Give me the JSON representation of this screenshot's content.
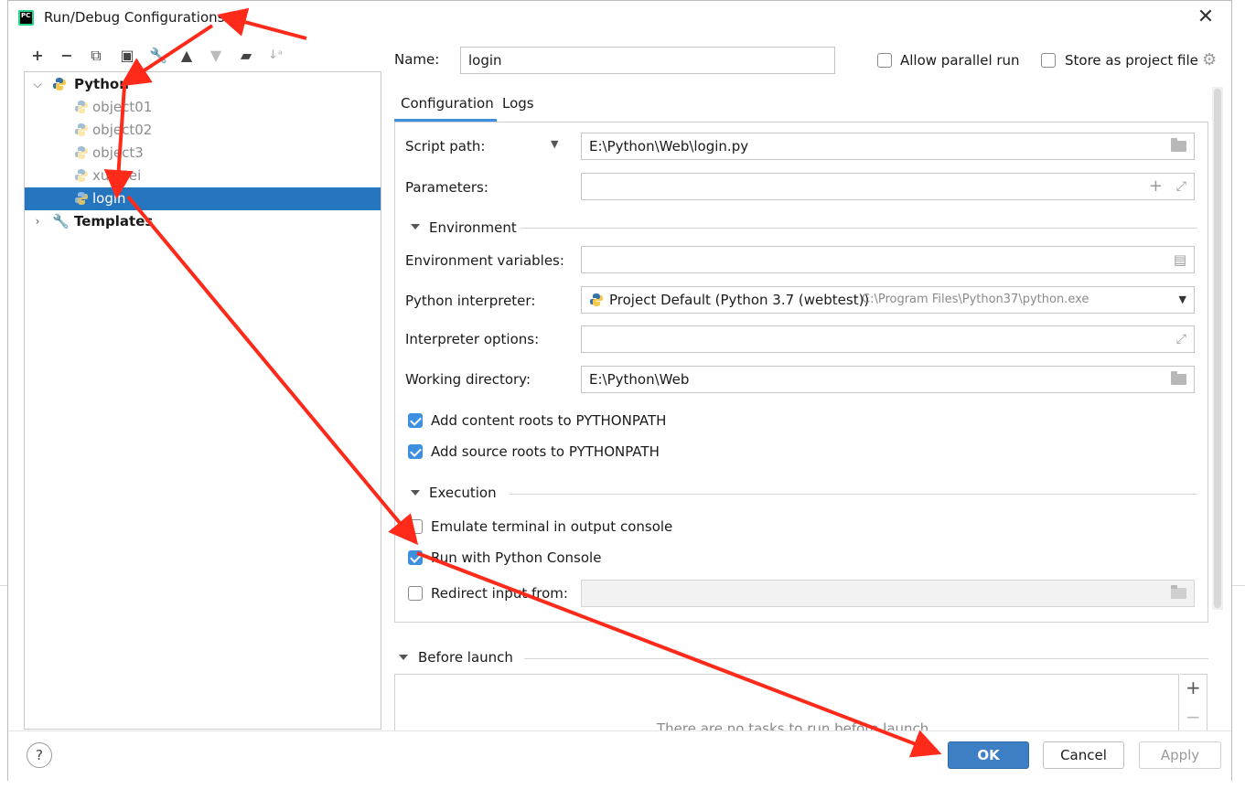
{
  "window": {
    "title": "Run/Debug Configurations",
    "close_icon": "close-icon"
  },
  "toolbar": {
    "icons": [
      "add-icon",
      "remove-icon",
      "copy-icon",
      "save-icon",
      "wrench-icon",
      "move-up-icon",
      "move-down-icon",
      "new-folder-icon",
      "sort-icon"
    ]
  },
  "tree": {
    "python_label": "Python",
    "items": [
      {
        "label": "object01"
      },
      {
        "label": "object02"
      },
      {
        "label": "object3"
      },
      {
        "label": "xuewei"
      },
      {
        "label": "login"
      }
    ],
    "templates_label": "Templates"
  },
  "header": {
    "name_label": "Name:",
    "name_value": "login",
    "allow_parallel_label": "Allow parallel run",
    "allow_parallel_checked": false,
    "store_project_label": "Store as project file",
    "store_project_checked": false
  },
  "tabs": [
    {
      "label": "Configuration",
      "active": true
    },
    {
      "label": "Logs",
      "active": false
    }
  ],
  "config": {
    "script_path_label": "Script path:",
    "script_path_value": "E:\\Python\\Web\\login.py",
    "parameters_label": "Parameters:",
    "parameters_value": "",
    "environment_section": "Environment",
    "env_vars_label": "Environment variables:",
    "env_vars_value": "",
    "interpreter_label": "Python interpreter:",
    "interpreter_value": "Project Default (Python 3.7 (webtest))",
    "interpreter_path": "C:\\Program Files\\Python37\\python.exe",
    "interp_options_label": "Interpreter options:",
    "interp_options_value": "",
    "working_dir_label": "Working directory:",
    "working_dir_value": "E:\\Python\\Web",
    "content_roots_label": "Add content roots to PYTHONPATH",
    "content_roots_checked": true,
    "source_roots_label": "Add source roots to PYTHONPATH",
    "source_roots_checked": true,
    "execution_section": "Execution",
    "emulate_terminal_label": "Emulate terminal in output console",
    "emulate_terminal_checked": false,
    "python_console_label": "Run with Python Console",
    "python_console_checked": true,
    "redirect_input_label": "Redirect input from:",
    "redirect_input_checked": false,
    "redirect_input_value": ""
  },
  "before_launch": {
    "section_label": "Before launch",
    "empty_text": "There are no tasks to run before launch"
  },
  "buttons": {
    "help": "?",
    "ok": "OK",
    "cancel": "Cancel",
    "apply": "Apply"
  },
  "colors": {
    "selection": "#2675bf",
    "checkbox_on": "#3d8fe0",
    "primary_button": "#3c7fc4",
    "annotation_arrow": "#ff2a1a"
  }
}
